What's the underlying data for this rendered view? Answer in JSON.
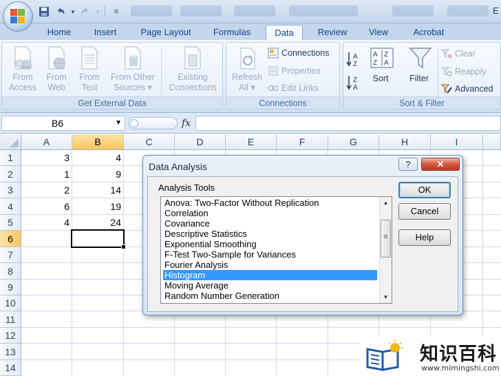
{
  "titlebar": {
    "right_text": "E"
  },
  "tabs": [
    {
      "label": "Home"
    },
    {
      "label": "Insert"
    },
    {
      "label": "Page Layout"
    },
    {
      "label": "Formulas"
    },
    {
      "label": "Data"
    },
    {
      "label": "Review"
    },
    {
      "label": "View"
    },
    {
      "label": "Acrobat"
    }
  ],
  "ribbon": {
    "get_external_data": {
      "label": "Get External Data",
      "buttons": [
        {
          "line1": "From",
          "line2": "Access"
        },
        {
          "line1": "From",
          "line2": "Web"
        },
        {
          "line1": "From",
          "line2": "Text"
        },
        {
          "line1": "From Other",
          "line2": "Sources ▾"
        },
        {
          "line1": "Existing",
          "line2": "Connections"
        }
      ]
    },
    "connections": {
      "label": "Connections",
      "refresh_line1": "Refresh",
      "refresh_line2": "All ▾",
      "connections": "Connections",
      "properties": "Properties",
      "edit_links": "Edit Links"
    },
    "sort_filter": {
      "label": "Sort & Filter",
      "sort": "Sort",
      "filter": "Filter",
      "clear": "Clear",
      "reapply": "Reapply",
      "advanced": "Advanced"
    }
  },
  "formula_bar": {
    "name_box": "B6",
    "fx": "fx",
    "formula": ""
  },
  "sheet": {
    "columns": [
      "A",
      "B",
      "C",
      "D",
      "E",
      "F",
      "G",
      "H",
      "I"
    ],
    "rows": [
      "1",
      "2",
      "3",
      "4",
      "5",
      "6",
      "7",
      "8",
      "9",
      "10",
      "11",
      "12",
      "13",
      "14"
    ],
    "column_a": [
      "3",
      "1",
      "2",
      "6",
      "4"
    ],
    "column_b": [
      "4",
      "9",
      "14",
      "19",
      "24"
    ],
    "selected_cell": "B6"
  },
  "dialog": {
    "title": "Data Analysis",
    "help_glyph": "?",
    "close_glyph": "✕",
    "tools_label": "Analysis Tools",
    "tools": [
      "Anova: Two-Factor Without Replication",
      "Correlation",
      "Covariance",
      "Descriptive Statistics",
      "Exponential Smoothing",
      "F-Test Two-Sample for Variances",
      "Fourier Analysis",
      "Histogram",
      "Moving Average",
      "Random Number Generation"
    ],
    "selected_tool": "Histogram",
    "ok": "OK",
    "cancel": "Cancel",
    "help": "Help"
  },
  "watermark": {
    "title": "知识百科",
    "url": "www.mimingshi.com"
  }
}
